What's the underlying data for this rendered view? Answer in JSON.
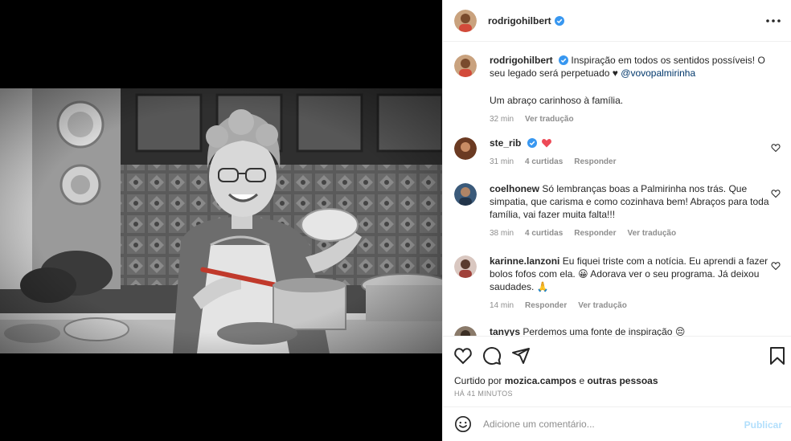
{
  "post": {
    "author": "rodrigohilbert",
    "caption_text": "Inspiração em todos os sentidos possíveis! O seu legado será perpetuado",
    "caption_heart": "♥",
    "caption_mention": "@vovopalmirinha",
    "caption_line2": "Um abraço carinhoso à família.",
    "caption_time": "32 min",
    "caption_translate": "Ver tradução"
  },
  "comments": [
    {
      "user": "ste_rib",
      "time": "31 min",
      "likes": "4 curtidas",
      "reply": "Responder"
    },
    {
      "user": "coelhonew",
      "text": "Só lembranças boas a Palmirinha nos trás. Que simpatia, que carisma e como cozinhava bem! Abraços para toda família, vai fazer muita falta!!!",
      "time": "38 min",
      "likes": "4 curtidas",
      "reply": "Responder",
      "translate": "Ver tradução"
    },
    {
      "user": "karinne.lanzoni",
      "text_a": "Eu fiquei triste com a notícia. Eu aprendi a fazer bolos fofos com ela.",
      "emoji_a": "😀",
      "text_b": "Adorava ver o seu programa. Já deixou saudades.",
      "emoji_b": "🙏",
      "time": "14 min",
      "reply": "Responder",
      "translate": "Ver tradução"
    },
    {
      "user": "tanyys",
      "text": "Perdemos uma fonte de inspiração",
      "emoji": "😔"
    }
  ],
  "liked_by": {
    "prefix": "Curtido por",
    "user": "mozica.campos",
    "mid": "e",
    "others": "outras pessoas"
  },
  "time_ago": "HÁ 41 MINUTOS",
  "add_comment": {
    "placeholder": "Adicione um comentário...",
    "publish": "Publicar"
  },
  "colors": {
    "verified": "#3897f0",
    "link": "#00376b",
    "muted": "#8e8e8e",
    "publish_disabled": "#b2dffc",
    "heart_red": "#ed4956"
  },
  "icons": [
    "more-icon",
    "verified-icon",
    "heart-icon",
    "comment-icon",
    "share-icon",
    "bookmark-icon",
    "emoji-icon"
  ]
}
